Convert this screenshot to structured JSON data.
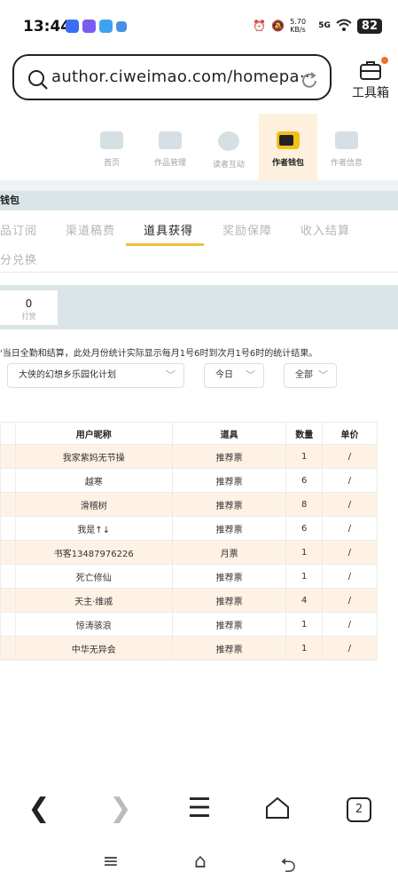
{
  "status_bar": {
    "time": "13:44",
    "net_speed": "5.70 KB/s",
    "signal": "5G",
    "battery": "82"
  },
  "browser": {
    "url": "author.ciweimao.com/homepa···",
    "toolbox_label": "工具箱"
  },
  "nav": {
    "items": [
      {
        "label": "首页",
        "icon": "house-icon"
      },
      {
        "label": "作品管理",
        "icon": "book-icon"
      },
      {
        "label": "读者互动",
        "icon": "paw-icon"
      },
      {
        "label": "作者钱包",
        "icon": "wallet-icon"
      },
      {
        "label": "作者信息",
        "icon": "id-card-icon"
      }
    ],
    "active_index": 3,
    "active_color": "#fdf1dd"
  },
  "section_title": "钱包",
  "tabs": {
    "items": [
      "品订阅",
      "渠道稿费",
      "道具获得",
      "奖励保障",
      "收入结算"
    ],
    "active_index": 2,
    "second_row": "分兑换",
    "underline_color": "#f0c040"
  },
  "stats": {
    "value": "0",
    "label": "打赏"
  },
  "note": "'当日全勤和结算，此处月份统计实际显示每月1号6时到次月1号6时的统计结果。",
  "filters": {
    "book": "大侠的幻想乡乐园化计划",
    "period": "今日",
    "type": "全部"
  },
  "table": {
    "headers": [
      "用户昵称",
      "道具",
      "数量",
      "单价"
    ],
    "rows": [
      {
        "user": "我家紫妈无节操",
        "item": "推荐票",
        "qty": "1",
        "price": "/"
      },
      {
        "user": "越寒",
        "item": "推荐票",
        "qty": "6",
        "price": "/"
      },
      {
        "user": "滑稽树",
        "item": "推荐票",
        "qty": "8",
        "price": "/"
      },
      {
        "user": "我是↑↓",
        "item": "推荐票",
        "qty": "6",
        "price": "/"
      },
      {
        "user": "书客13487976226",
        "item": "月票",
        "qty": "1",
        "price": "/"
      },
      {
        "user": "死亡修仙",
        "item": "推荐票",
        "qty": "1",
        "price": "/"
      },
      {
        "user": "天主·维戚",
        "item": "推荐票",
        "qty": "4",
        "price": "/"
      },
      {
        "user": "惊涛骇浪",
        "item": "推荐票",
        "qty": "1",
        "price": "/"
      },
      {
        "user": "中华无异会",
        "item": "推荐票",
        "qty": "1",
        "price": "/"
      }
    ],
    "odd_row_color": "#fdf2e4"
  },
  "bottom_nav": {
    "back": "❮",
    "forward": "❯",
    "menu": "☰",
    "home": "⌂",
    "tabs_count": "2"
  },
  "system_nav": {
    "menu": "≡",
    "home": "⌂",
    "back": "⮌"
  }
}
